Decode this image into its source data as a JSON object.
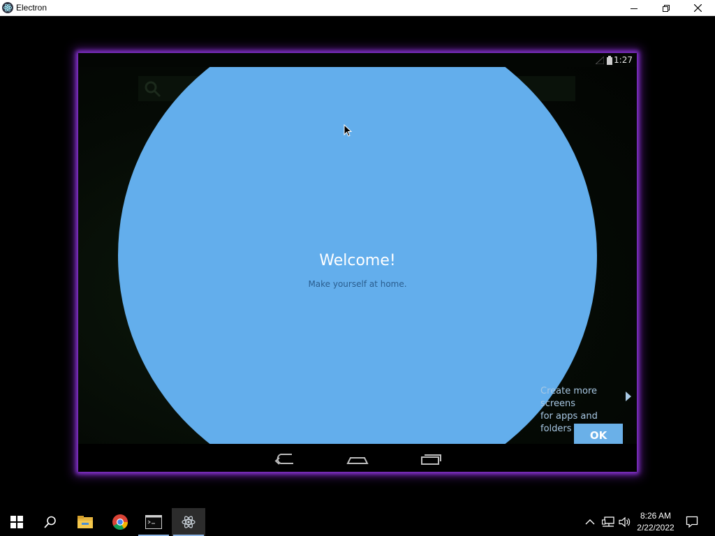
{
  "window": {
    "title": "Electron"
  },
  "device": {
    "status_time": "1:27",
    "welcome_title": "Welcome!",
    "welcome_subtitle": "Make yourself at home.",
    "hint_line1": "Create more screens",
    "hint_line2": "for apps and folders",
    "ok_label": "OK",
    "circle_color": "#63aeec"
  },
  "taskbar": {
    "apps": [
      {
        "name": "start",
        "icon": "windows-start-icon"
      },
      {
        "name": "search",
        "icon": "search-icon"
      },
      {
        "name": "file-explorer",
        "icon": "folder-icon"
      },
      {
        "name": "chrome",
        "icon": "chrome-icon"
      },
      {
        "name": "terminal",
        "icon": "terminal-icon"
      },
      {
        "name": "electron",
        "icon": "electron-icon",
        "active": true
      }
    ],
    "time": "8:26 AM",
    "date": "2/22/2022"
  }
}
